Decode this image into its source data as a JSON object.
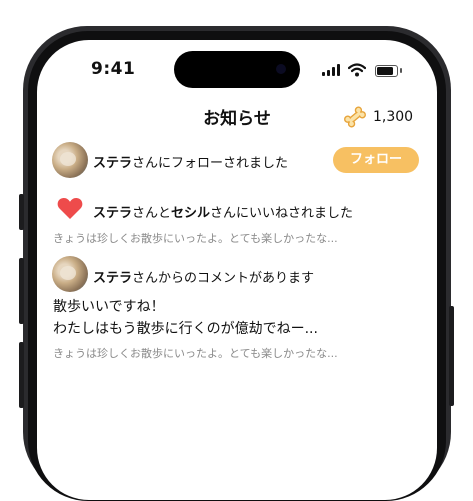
{
  "status_bar": {
    "time": "9:41",
    "icons": [
      "signal-icon",
      "wifi-icon",
      "battery-icon"
    ]
  },
  "header": {
    "title": "お知らせ",
    "points_icon": "bone-icon",
    "points": "1,300"
  },
  "notifications": [
    {
      "type": "follow",
      "icon": "avatar",
      "name": "ステラ",
      "text": "さんにフォローされました",
      "button_label": "フォロー"
    },
    {
      "type": "like",
      "icon": "heart-icon",
      "name": "ステラ",
      "mid": "さんと",
      "name2": "セシル",
      "text": "さんにいいねされました",
      "preview": "きょうは珍しくお散歩にいったよ。とても楽しかったな..."
    },
    {
      "type": "comment",
      "icon": "avatar",
      "name": "ステラ",
      "text": "さんからのコメントがあります",
      "comment_line1": "散歩いいですね！",
      "comment_line2": "わたしはもう散歩に行くのが億劫でねー...",
      "preview": "きょうは珍しくお散歩にいったよ。とても楽しかったな..."
    }
  ],
  "colors": {
    "accent": "#f7c062",
    "heart": "#ee4b4b",
    "muted_text": "#8a8a8a",
    "frame": "#2b2b2e"
  }
}
